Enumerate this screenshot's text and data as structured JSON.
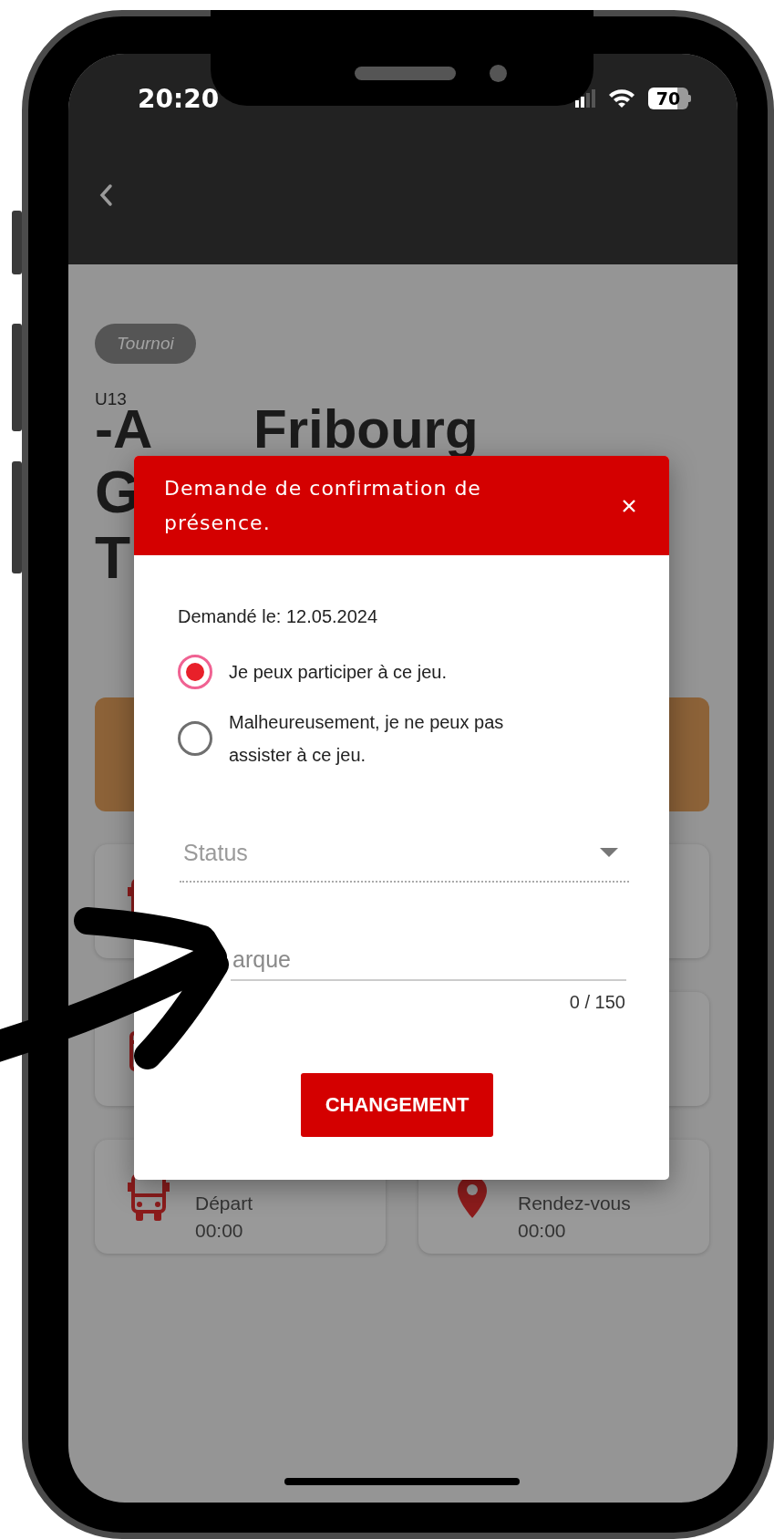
{
  "status_bar": {
    "time": "20:20",
    "battery": "70"
  },
  "event": {
    "type_chip": "Tournoi",
    "category": "U13",
    "title_lines": [
      [
        "-A",
        "Fribourg"
      ],
      [
        "G"
      ],
      [
        "T"
      ]
    ]
  },
  "info_cards": [
    {
      "kind": "bus"
    },
    {
      "kind": "blank"
    },
    {
      "kind": "calendar"
    },
    {
      "kind": "blank"
    },
    {
      "kind": "bus",
      "label": "Départ",
      "value": "00:00"
    },
    {
      "kind": "pin",
      "label": "Rendez-vous",
      "value": "00:00"
    }
  ],
  "dialog": {
    "title": "Demande de confirmation de présence.",
    "requested": "Demandé le: 12.05.2024",
    "options": [
      {
        "label": "Je peux participer à ce jeu.",
        "selected": true
      },
      {
        "label": "Malheureusement, je ne peux pas assister à ce jeu.",
        "selected": false
      }
    ],
    "status_field": {
      "placeholder": "Status"
    },
    "remark_field": {
      "placeholder": "arque",
      "counter": "0 / 150"
    },
    "button": "CHANGEMENT"
  }
}
